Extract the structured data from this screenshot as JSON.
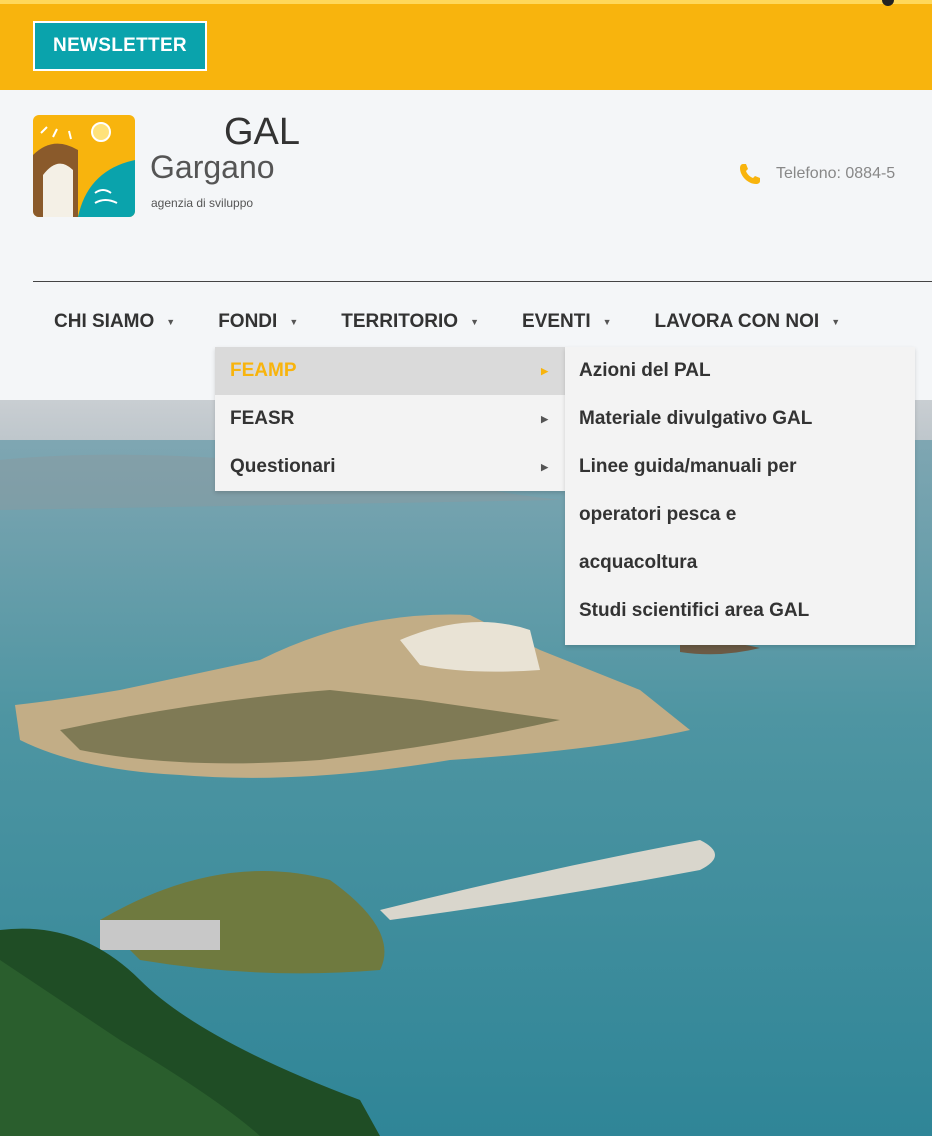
{
  "topbar": {
    "newsletter_label": "NEWSLETTER"
  },
  "brand": {
    "name_top": "GAL",
    "name_bottom": "Gargano",
    "tagline": "agenzia di sviluppo"
  },
  "contact": {
    "phone_text": "Telefono: 0884-5"
  },
  "nav": [
    {
      "label": "CHI SIAMO"
    },
    {
      "label": "FONDI"
    },
    {
      "label": "TERRITORIO"
    },
    {
      "label": "EVENTI"
    },
    {
      "label": "LAVORA CON NOI"
    }
  ],
  "fondi_menu": [
    {
      "label": "FEAMP",
      "active": true
    },
    {
      "label": "FEASR",
      "active": false
    },
    {
      "label": "Questionari",
      "active": false
    }
  ],
  "feamp_submenu": [
    {
      "label": "Azioni del PAL"
    },
    {
      "label": "Materiale divulgativo GAL"
    },
    {
      "label": "Linee guida/manuali per"
    },
    {
      "label": "operatori pesca e"
    },
    {
      "label": "acquacoltura"
    },
    {
      "label": "Studi scientifici area GAL"
    }
  ],
  "colors": {
    "accent": "#f8b40d",
    "newsletter_bg": "#0aa3ac",
    "sea": "#3f8f9c"
  },
  "icons": {
    "phone": "phone-icon",
    "caret": "caret-down-icon",
    "arrow": "chevron-right-icon"
  }
}
